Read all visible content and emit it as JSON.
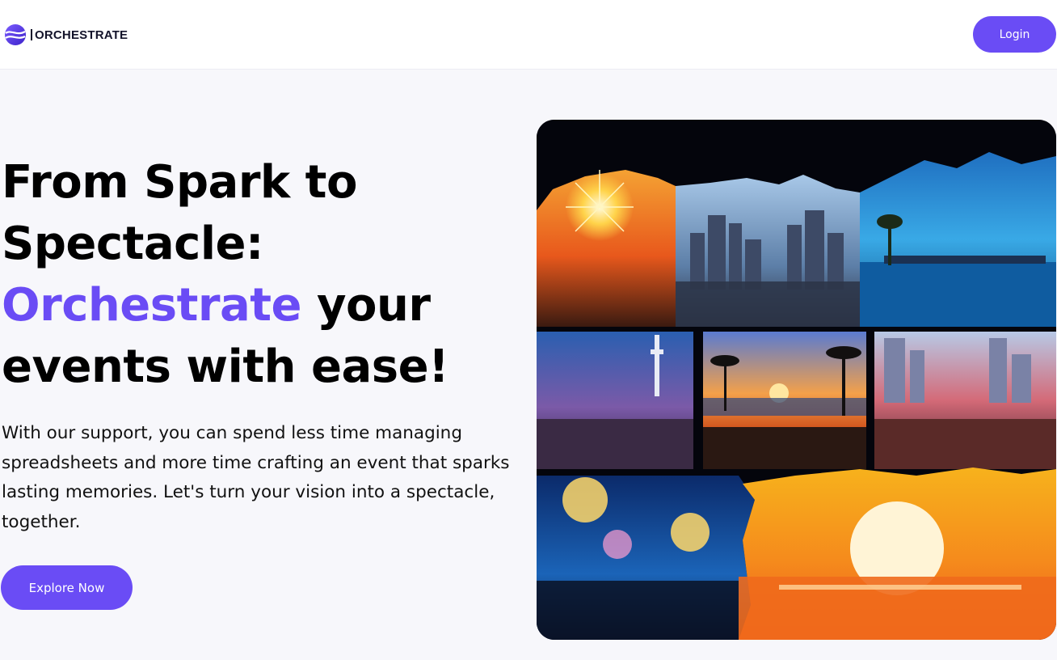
{
  "header": {
    "brand_name": "ORCHESTRATE",
    "logo_icon": "globe-wave-icon",
    "login_label": "Login"
  },
  "hero": {
    "headline_line1": "From Spark to",
    "headline_line2": "Spectacle:",
    "headline_accent": "Orchestrate",
    "headline_line3_rest": " your",
    "headline_line4": "events with ease!",
    "description": "With our support, you can spend less time managing spreadsheets and more time crafting an event that sparks lasting memories. Let's turn your vision into a spectacle, together.",
    "cta_label": "Explore Now"
  },
  "collage": {
    "panels": [
      "fireworks-crowd",
      "city-skyline-crowd",
      "waterfront-palm",
      "tower-night-crowd",
      "sunset-palms",
      "city-fireworks-crowd",
      "blue-fireworks-crowd",
      "orange-sunset-sea"
    ]
  },
  "colors": {
    "accent": "#6a4cf5",
    "page_background": "#f7f7fb",
    "header_background": "#ffffff",
    "text": "#000000"
  }
}
